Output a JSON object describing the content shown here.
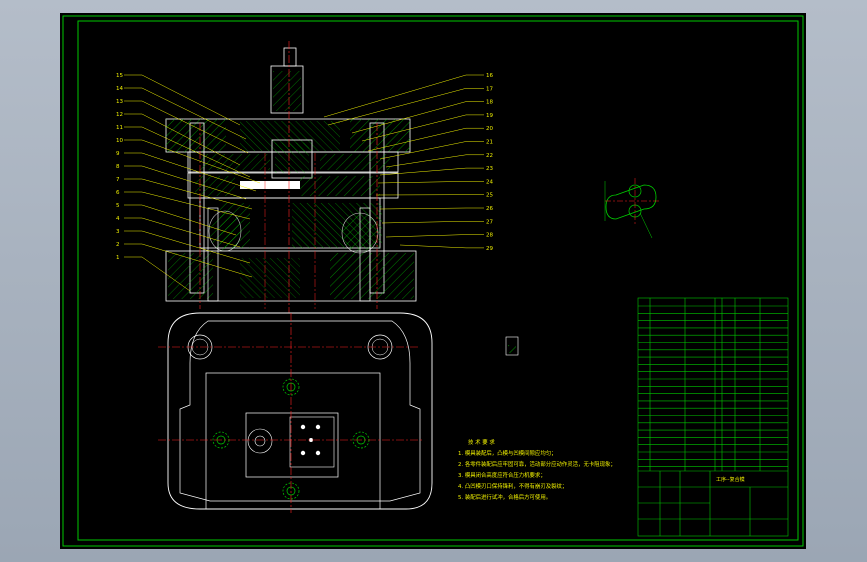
{
  "drawing": {
    "title": "工序--复合模",
    "left_callouts": [
      "15",
      "14",
      "13",
      "12",
      "11",
      "10",
      "9",
      "8",
      "7",
      "6",
      "5",
      "4",
      "3",
      "2",
      "1"
    ],
    "right_callouts": [
      "16",
      "17",
      "18",
      "19",
      "20",
      "21",
      "22",
      "23",
      "24",
      "25",
      "26",
      "27",
      "28",
      "29"
    ],
    "notes_title": "技 术 要 求",
    "notes": [
      "1. 模具装配后，凸模与凹模间隙应均匀；",
      "2. 各零件装配后应牢固可靠，活动部分应动作灵活，无卡阻现象；",
      "3. 模具闭合高度应符合压力机要求；",
      "4. 凸凹模刃口保持锋利，不得有崩刃及裂纹；",
      "5. 装配后进行试冲，合格后方可使用。"
    ]
  },
  "colors": {
    "background": "#000000",
    "border": "#00c800",
    "outline": "#ffffff",
    "centerline": "#ff2020",
    "hatch": "#00d000",
    "text": "#f2f200",
    "frame": "#b4bdc9"
  }
}
